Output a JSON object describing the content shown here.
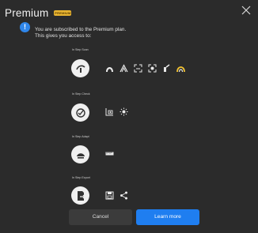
{
  "dialog": {
    "title": "Premium",
    "badge": "PREMIUM",
    "message_line1": "You are subscribed to the Premium plan.",
    "message_line2": "This gives you access to:"
  },
  "sections": [
    {
      "label": "In Step Scan"
    },
    {
      "label": "In Step Check"
    },
    {
      "label": "In Step Adapt"
    },
    {
      "label": "In Step Export"
    }
  ],
  "buttons": {
    "cancel": "Cancel",
    "learn_more": "Learn more"
  },
  "colors": {
    "background": "#2b2b2b",
    "badge": "#e9b531",
    "accent": "#1f7ef0",
    "info": "#2f86ea",
    "highlight_tool": "#f1c232"
  }
}
